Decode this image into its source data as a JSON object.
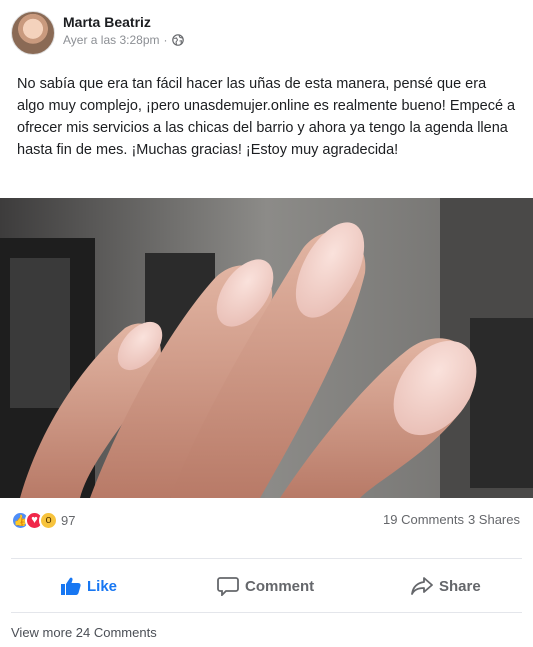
{
  "post": {
    "author": "Marta Beatriz",
    "time": "Ayer a las 3:28pm",
    "visibility_icon": "globe-icon",
    "text": "No sabía que era tan fácil hacer las uñas de esta manera, pensé que era algo muy complejo, ¡pero unasdemujer.online es realmente bueno! Empecé a ofrecer mis servicios a las chicas del barrio y ahora ya tengo la agenda llena hasta fin de mes. ¡Muchas gracias! ¡Estoy muy agradecida!"
  },
  "reactions": {
    "icons": [
      "like-icon",
      "love-icon",
      "wow-icon"
    ],
    "count": "97"
  },
  "stats": {
    "comments": "19 Comments",
    "shares": "3 Shares"
  },
  "actions": {
    "like": "Like",
    "comment": "Comment",
    "share": "Share"
  },
  "footer": {
    "view_more": "View more 24 Comments"
  },
  "colors": {
    "accent": "#1877f2",
    "muted": "#65676b",
    "nail_polish": "#f2cfc7"
  }
}
